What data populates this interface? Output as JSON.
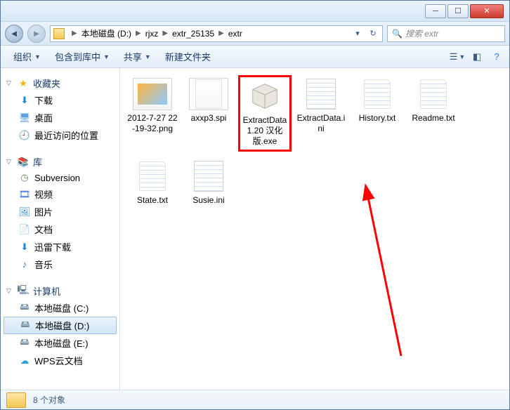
{
  "breadcrumb": {
    "drive": "本地磁盘 (D:)",
    "p1": "rjxz",
    "p2": "extr_25135",
    "p3": "extr"
  },
  "search": {
    "placeholder": "搜索 extr"
  },
  "toolbar": {
    "organize": "组织",
    "include": "包含到库中",
    "share": "共享",
    "newfolder": "新建文件夹"
  },
  "sidebar": {
    "fav": {
      "header": "收藏夹",
      "downloads": "下载",
      "desktop": "桌面",
      "recent": "最近访问的位置"
    },
    "lib": {
      "header": "库",
      "subversion": "Subversion",
      "video": "视频",
      "pictures": "图片",
      "docs": "文档",
      "xunlei": "迅雷下载",
      "music": "音乐"
    },
    "comp": {
      "header": "计算机",
      "c": "本地磁盘 (C:)",
      "d": "本地磁盘 (D:)",
      "e": "本地磁盘 (E:)",
      "wps": "WPS云文档"
    }
  },
  "files": {
    "f0": "2012-7-27 22-19-32.png",
    "f1": "axxp3.spi",
    "f2": "ExtractData 1.20 汉化版.exe",
    "f3": "ExtractData.ini",
    "f4": "History.txt",
    "f5": "Readme.txt",
    "f6": "State.txt",
    "f7": "Susie.ini"
  },
  "status": {
    "count": "8 个对象"
  }
}
